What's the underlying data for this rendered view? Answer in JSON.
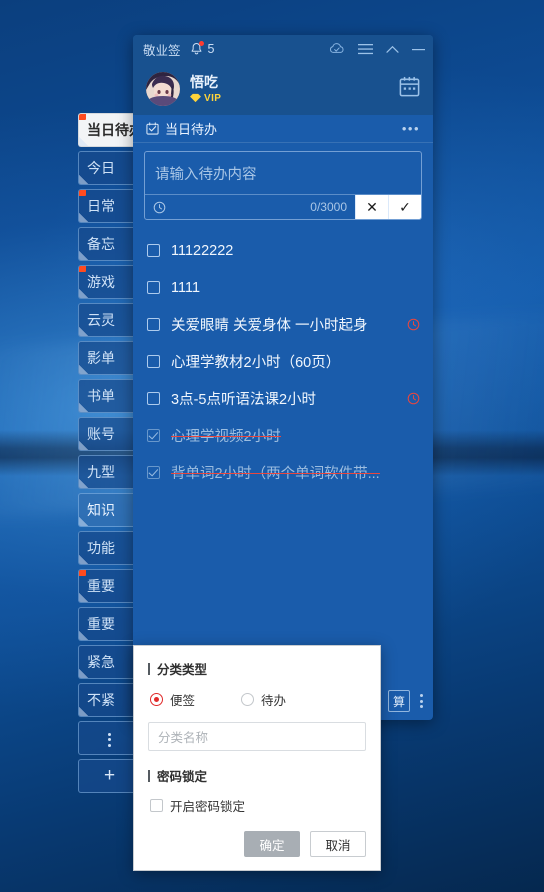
{
  "window": {
    "app_title": "敬业签",
    "notification_count": "5",
    "icons": {
      "bell": "bell-icon",
      "cloud_sync": "cloud-sync-icon",
      "menu": "hamburger-menu-icon",
      "collapse": "chevron-up-icon",
      "minimize": "minimize-icon"
    }
  },
  "profile": {
    "username": "悟吃",
    "vip_label": "VIP",
    "calendar_icon": "calendar-icon"
  },
  "todo_panel": {
    "title": "当日待办",
    "header_icon": "calendar-check-icon",
    "more_icon": "ellipsis-icon",
    "input_placeholder": "请输入待办内容",
    "char_counter": "0/3000",
    "clock_icon": "clock-icon",
    "cancel_glyph": "✕",
    "confirm_glyph": "✓"
  },
  "todos": [
    {
      "text": "11122222",
      "done": false,
      "reminder": false
    },
    {
      "text": "1111",
      "done": false,
      "reminder": false
    },
    {
      "text": "关爱眼睛 关爱身体 一小时起身",
      "done": false,
      "reminder": true
    },
    {
      "text": "心理学教材2小时（60页）",
      "done": false,
      "reminder": false
    },
    {
      "text": "3点-5点听语法课2小时",
      "done": false,
      "reminder": true
    },
    {
      "text": "心理学视频2小时",
      "done": true,
      "reminder": false
    },
    {
      "text": "背单词2小时（两个单词软件带...",
      "done": true,
      "reminder": false
    }
  ],
  "app_bottom": {
    "calc_label": "算",
    "more_icon": "vertical-ellipsis-icon"
  },
  "sidebar": {
    "items": [
      {
        "label": "当日待办",
        "active": true,
        "selected": false,
        "dot": true
      },
      {
        "label": "今日",
        "active": false,
        "selected": false,
        "dot": false
      },
      {
        "label": "日常",
        "active": false,
        "selected": false,
        "dot": true
      },
      {
        "label": "备忘",
        "active": false,
        "selected": false,
        "dot": false
      },
      {
        "label": "游戏",
        "active": false,
        "selected": false,
        "dot": true
      },
      {
        "label": "云灵",
        "active": false,
        "selected": false,
        "dot": false
      },
      {
        "label": "影单",
        "active": false,
        "selected": false,
        "dot": false
      },
      {
        "label": "书单",
        "active": false,
        "selected": false,
        "dot": false
      },
      {
        "label": "账号",
        "active": false,
        "selected": false,
        "dot": false
      },
      {
        "label": "九型",
        "active": false,
        "selected": false,
        "dot": false
      },
      {
        "label": "知识",
        "active": false,
        "selected": true,
        "dot": false
      },
      {
        "label": "功能",
        "active": false,
        "selected": false,
        "dot": false
      },
      {
        "label": "重要",
        "active": false,
        "selected": false,
        "dot": true
      },
      {
        "label": "重要",
        "active": false,
        "selected": false,
        "dot": false
      },
      {
        "label": "紧急",
        "active": false,
        "selected": false,
        "dot": false
      },
      {
        "label": "不紧",
        "active": false,
        "selected": false,
        "dot": false
      }
    ],
    "more_icon": "vertical-ellipsis-icon",
    "add_label": "+"
  },
  "dialog": {
    "type_section_label": "分类类型",
    "radio_options": [
      {
        "label": "便签",
        "checked": true
      },
      {
        "label": "待办",
        "checked": false
      }
    ],
    "name_placeholder": "分类名称",
    "lock_section_label": "密码锁定",
    "lock_checkbox_label": "开启密码锁定",
    "lock_checked": false,
    "confirm_label": "确定",
    "cancel_label": "取消"
  },
  "colors": {
    "panel_blue": "#1a5cab",
    "header_blue": "#18518f",
    "accent_red": "#e02a2a",
    "strike_red": "#e8473f",
    "vip_gold": "#ffd43a",
    "badge_red": "#ff3b30"
  }
}
